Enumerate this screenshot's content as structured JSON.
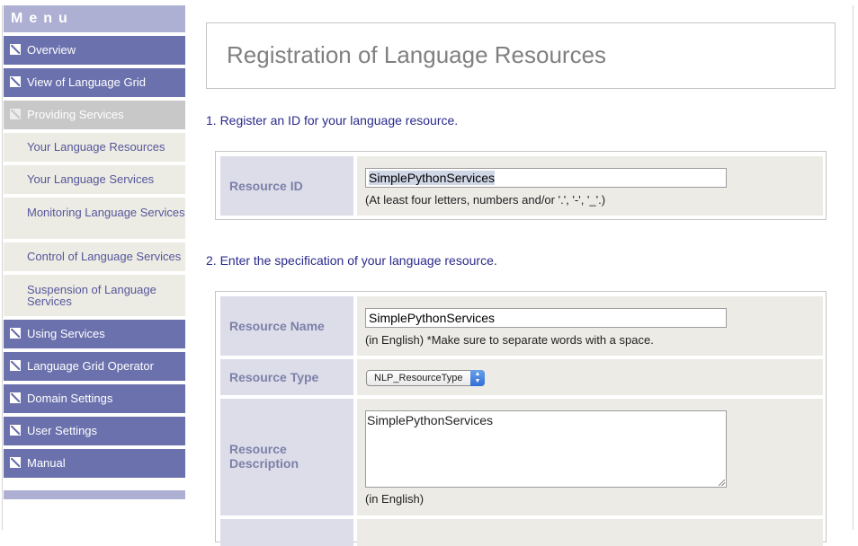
{
  "sidebar": {
    "title": "Menu",
    "items": [
      {
        "label": "Overview"
      },
      {
        "label": "View of Language Grid"
      },
      {
        "label": "Providing Services"
      },
      {
        "label": "Your Language Resources"
      },
      {
        "label": "Your Language Services"
      },
      {
        "label": "Monitoring Language Services"
      },
      {
        "label": "Control of Language Services"
      },
      {
        "label": "Suspension of Language Services"
      },
      {
        "label": "Using Services"
      },
      {
        "label": "Language Grid Operator"
      },
      {
        "label": "Domain Settings"
      },
      {
        "label": "User Settings"
      },
      {
        "label": "Manual"
      }
    ]
  },
  "main": {
    "page_title": "Registration of Language Resources",
    "section1": {
      "heading": "1. Register an ID for your language resource.",
      "resource_id_label": "Resource ID",
      "resource_id_value": "SimplePythonServices",
      "resource_id_hint": "(At least four letters, numbers and/or '.', '-', '_'.)"
    },
    "section2": {
      "heading": "2. Enter the specification of your language resource.",
      "resource_name_label": "Resource Name",
      "resource_name_value": "SimplePythonServices",
      "resource_name_hint": "(in English) *Make sure to separate words with a space.",
      "resource_type_label": "Resource Type",
      "resource_type_value": "NLP_ResourceType",
      "description_label": "Resource Description",
      "description_value": "SimplePythonServices",
      "description_hint": "(in English)"
    }
  },
  "colors": {
    "nav_main": "#6b71ad",
    "nav_active": "#c8c8c8",
    "nav_sub": "#ecebe4",
    "label_bg": "#dcdde9",
    "heading_text": "#2a2a8c"
  }
}
